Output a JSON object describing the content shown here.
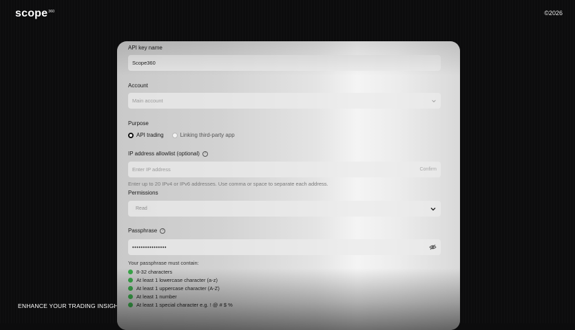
{
  "brand": {
    "logo": "scope",
    "logo_sup": "360"
  },
  "copyright": "©2026",
  "tagline": "ENHANCE YOUR TRADING INSIGHTS",
  "form": {
    "api_key_name": {
      "label": "API key name",
      "value": "Scope360"
    },
    "account": {
      "label": "Account",
      "placeholder": "Main account"
    },
    "purpose": {
      "label": "Purpose",
      "options": [
        {
          "label": "API trading",
          "selected": true
        },
        {
          "label": "Linking third-party app",
          "selected": false
        }
      ]
    },
    "ip_allowlist": {
      "label": "IP address allowlist (optional)",
      "placeholder": "Enter IP address",
      "confirm_label": "Confirm",
      "hint": "Enter up to 20 IPv4 or IPv6 addresses. Use comma or space to separate each address."
    },
    "permissions": {
      "label": "Permissions",
      "selected": "Read"
    },
    "passphrase": {
      "label": "Passphrase",
      "value": "••••••••••••••••",
      "requirements_title": "Your passphrase must contain:",
      "requirements": [
        "8-32 characters",
        "At least 1 lowercase character (a-z)",
        "At least 1 uppercase character (A-Z)",
        "At least 1 number",
        "At least 1 special character e.g. ! @ # $ %"
      ]
    }
  },
  "colors": {
    "background": "#0c0c0d",
    "check_green": "#3aa64a",
    "radio_selected": "#111111"
  },
  "icons": {
    "help": "question-circle-icon",
    "dropdown": "chevron-down-icon",
    "visibility": "eye-off-icon",
    "check": "check-circle-icon"
  }
}
